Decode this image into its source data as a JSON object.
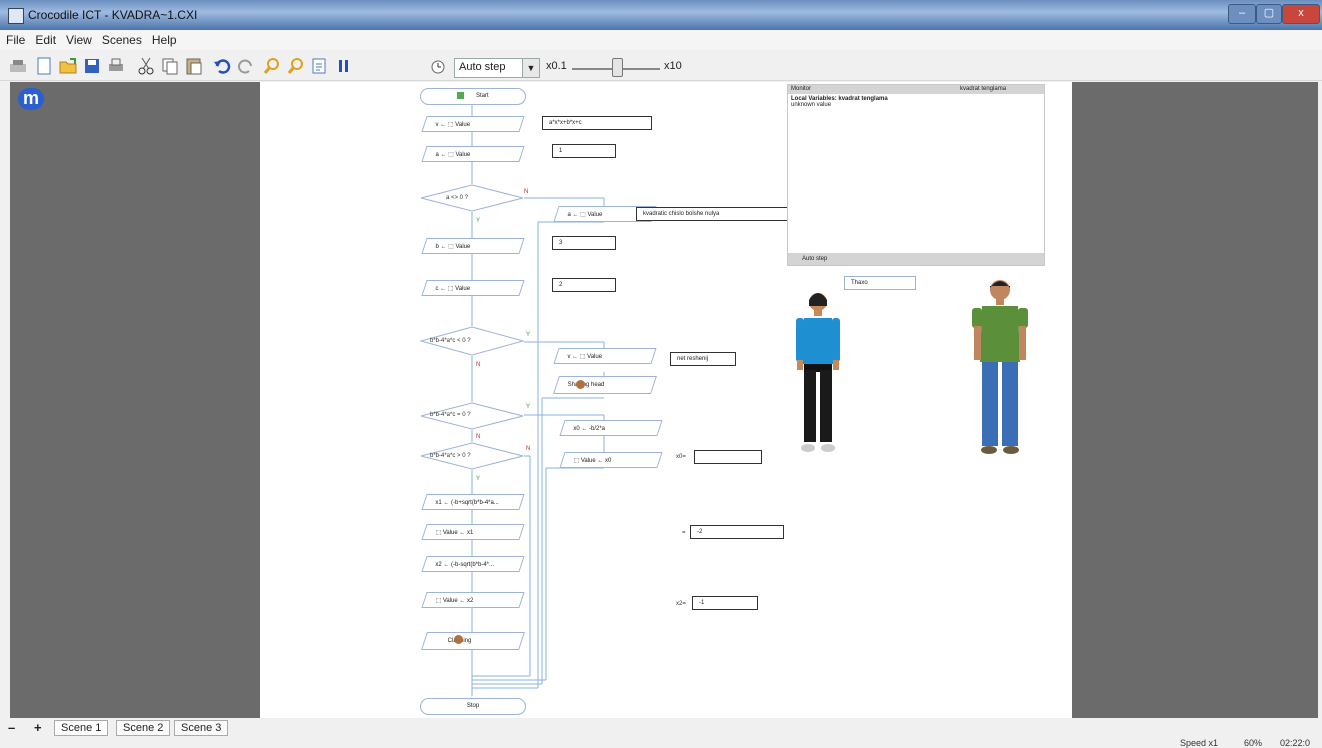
{
  "window": {
    "title": "Crocodile ICT - KVADRA~1.CXI",
    "min": "–",
    "max": "▢",
    "close": "x"
  },
  "menu": [
    "File",
    "Edit",
    "View",
    "Scenes",
    "Help"
  ],
  "toolbar": {
    "step_mode": "Auto step",
    "speed_min": "x0.1",
    "speed_max": "x10"
  },
  "logo": "m",
  "flow": {
    "start": "Start",
    "v_assign": "v ← ⬚ Value",
    "a_assign": "a ← ⬚ Value",
    "cond_a": "a <> 0 ?",
    "a_msg_assign": "a ← ⬚ Value",
    "b_assign": "b ← ⬚ Value",
    "c_assign": "c ← ⬚ Value",
    "cond_neg": "b*b-4*a*c < 0 ?",
    "v2_assign": "v ← ⬚ Value",
    "shaking_head": "Shaking head",
    "cond_zero": "b*b-4*a*c = 0 ?",
    "x0_assign": "x0 ← -b/2*a",
    "x0_out": "⬚ Value ← x0",
    "cond_pos": "b*b-4*a*c > 0 ?",
    "x1_assign": "x1 ← (-b+sqrt(b*b-4*a...",
    "x1_out": "⬚ Value ← x1",
    "x2_assign": "x2 ← (-b-sqrt(b*b-4*...",
    "x2_out": "⬚ Value ← x2",
    "clapping": "Clapping",
    "stop": "Stop",
    "yes": "Y",
    "no": "N"
  },
  "outputs": {
    "equation": "a*x*x+b*x+c",
    "a_val": "1",
    "error_msg": "kvadratic chislo bolshe nulya",
    "b_val": "3",
    "c_val": "2",
    "no_roots": "net reshenij",
    "x0_label": "x0=",
    "x0_val": "",
    "x1_label": "=",
    "x1_val": "-2",
    "x2_label": "x2=",
    "x2_val": "-1",
    "speech": "Thaxo"
  },
  "monitor": {
    "title": "Monitor",
    "subtitle": "kvadrat tenglama",
    "line1": "Local Variables: kvadrat tenglama",
    "line2": "unknown value",
    "footer": "Auto step"
  },
  "scenes": {
    "minus": "–",
    "plus": "+",
    "tabs": [
      "Scene 1",
      "Scene 2",
      "Scene 3"
    ]
  },
  "status": {
    "speed": "Speed x1",
    "zoom": "60%",
    "time": "02:22:0"
  }
}
